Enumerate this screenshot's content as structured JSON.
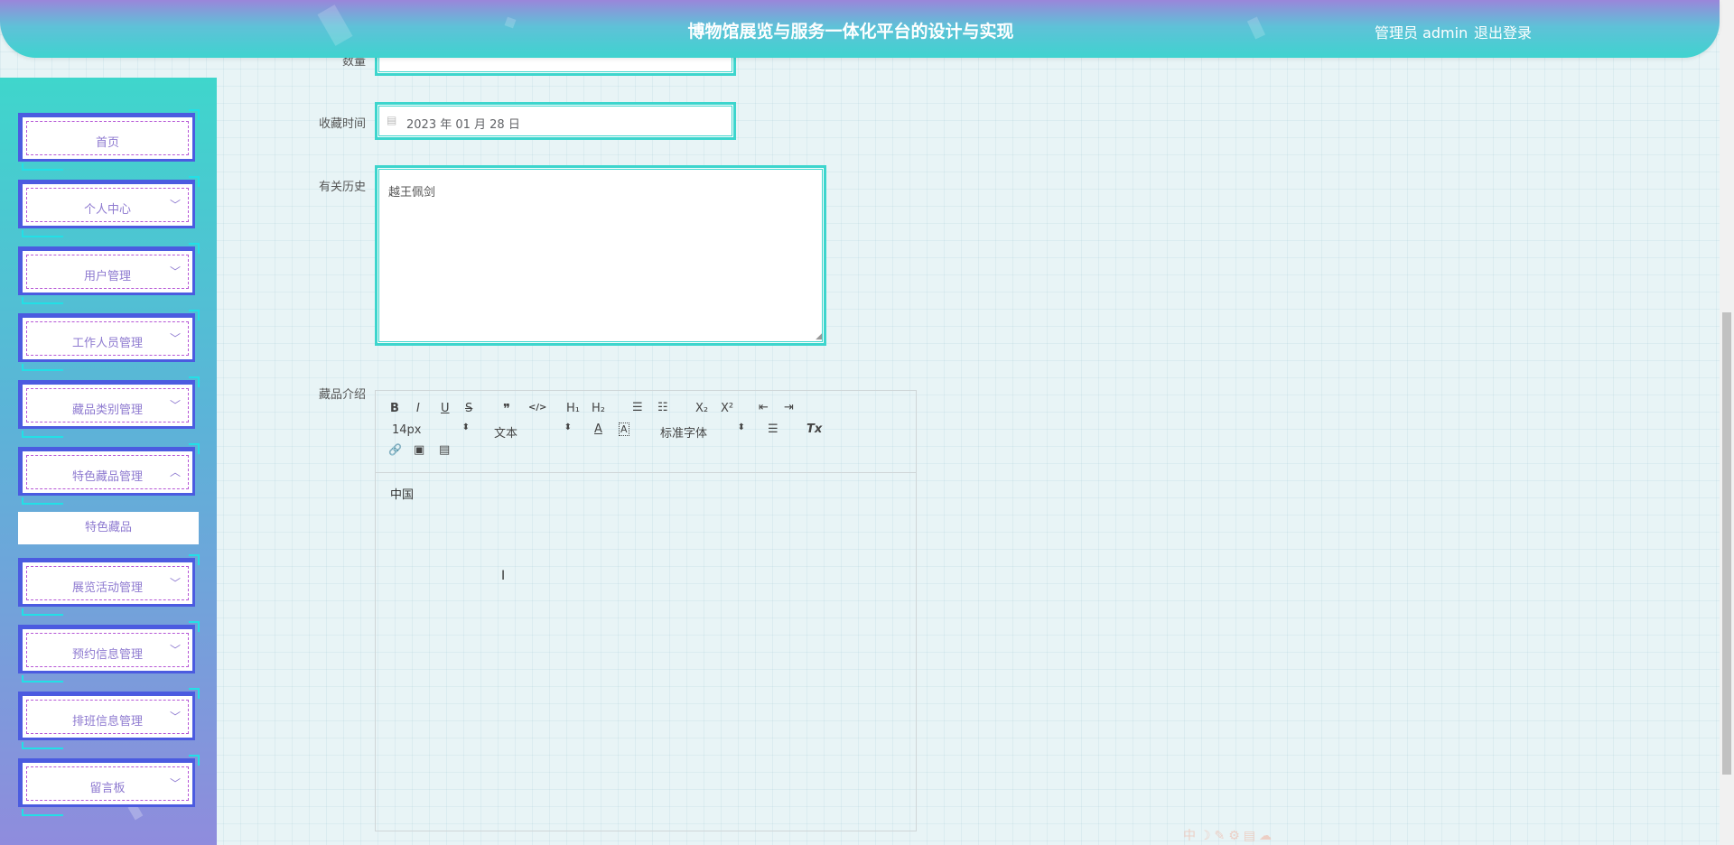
{
  "header": {
    "title": "博物馆展览与服务一体化平台的设计与实现",
    "user": "管理员 admin",
    "logout": "退出登录"
  },
  "sidebar": {
    "items": [
      {
        "label": "首页",
        "chevron": ""
      },
      {
        "label": "个人中心",
        "chevron": "﹀"
      },
      {
        "label": "用户管理",
        "chevron": "﹀"
      },
      {
        "label": "工作人员管理",
        "chevron": "﹀"
      },
      {
        "label": "藏品类别管理",
        "chevron": "﹀"
      },
      {
        "label": "特色藏品管理",
        "chevron": "︿"
      },
      {
        "label": "展览活动管理",
        "chevron": "﹀"
      },
      {
        "label": "预约信息管理",
        "chevron": "﹀"
      },
      {
        "label": "排班信息管理",
        "chevron": "﹀"
      },
      {
        "label": "留言板",
        "chevron": "﹀"
      }
    ],
    "sub_item": "特色藏品"
  },
  "form": {
    "quantity_label": "数量",
    "collect_time_label": "收藏时间",
    "collect_time_value": "2023 年 01 月 28 日",
    "history_label": "有关历史",
    "history_value": "越王佩剑",
    "intro_label": "藏品介绍",
    "intro_value": "中国"
  },
  "editor_toolbar": {
    "bold": "B",
    "italic": "I",
    "underline": "U",
    "strike": "S",
    "quote": "❞",
    "code": "</>",
    "h1": "H₁",
    "h2": "H₂",
    "ordered_list": "☰",
    "bullet_list": "☷",
    "subscript": "X₂",
    "superscript": "X²",
    "outdent": "⇤",
    "indent": "⇥",
    "size": "14px",
    "header": "文本",
    "color": "A",
    "background": "A",
    "font": "标准字体",
    "align": "☰",
    "clean": "Tx",
    "link": "🔗",
    "image": "▣",
    "video": "▤"
  },
  "colors": {
    "accent": "#3dd5cd",
    "menu_text": "#8e7ad0",
    "menu_border": "#4b5be0"
  }
}
